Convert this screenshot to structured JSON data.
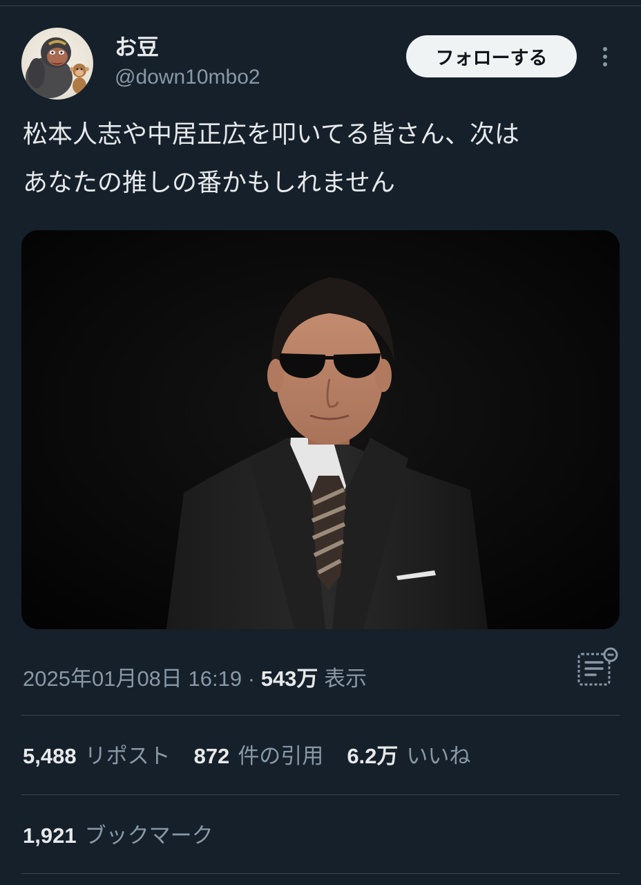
{
  "user": {
    "display_name": "お豆",
    "handle": "@down10mbo2"
  },
  "header": {
    "follow_label": "フォローする"
  },
  "tweet": {
    "text": "松本人志や中居正広を叩いてる皆さん、次は\nあなたの推しの番かもしれません"
  },
  "meta": {
    "timestamp": "2025年01月08日 16:19",
    "separator": "·",
    "views_count": "543万",
    "views_label": "表示"
  },
  "stats": {
    "reposts_count": "5,488",
    "reposts_label": "リポスト",
    "quotes_count": "872",
    "quotes_label": "件の引用",
    "likes_count": "6.2万",
    "likes_label": "いいね",
    "bookmarks_count": "1,921",
    "bookmarks_label": "ブックマーク"
  },
  "icons": {
    "more": "more-vertical-icon",
    "analytics": "analytics-icon"
  },
  "colors": {
    "background": "#15202b",
    "text_primary": "#e7e9ea",
    "text_secondary": "#8b98a5",
    "divider": "#38444d",
    "follow_button_bg": "#eff3f4"
  }
}
